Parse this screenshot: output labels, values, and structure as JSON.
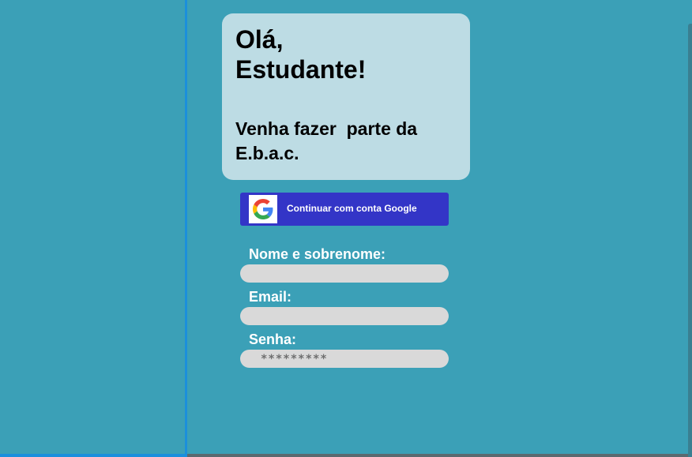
{
  "welcome": {
    "greeting_line1": "Olá,",
    "greeting_line2": "Estudante!",
    "invite_line1": "Venha fazer  parte da",
    "invite_line2": "E.b.a.c."
  },
  "google_button": {
    "label": "Continuar com conta Google",
    "icon": "google-g-icon"
  },
  "form": {
    "name_label": "Nome e sobrenome:",
    "name_value": "",
    "email_label": "Email:",
    "email_value": "",
    "password_label": "Senha:",
    "password_value": "*********"
  },
  "colors": {
    "background": "#3ba0b7",
    "card": "#bddce4",
    "google_button": "#3335c7",
    "input": "#d9d9d9",
    "divider": "#1b8fdc"
  }
}
